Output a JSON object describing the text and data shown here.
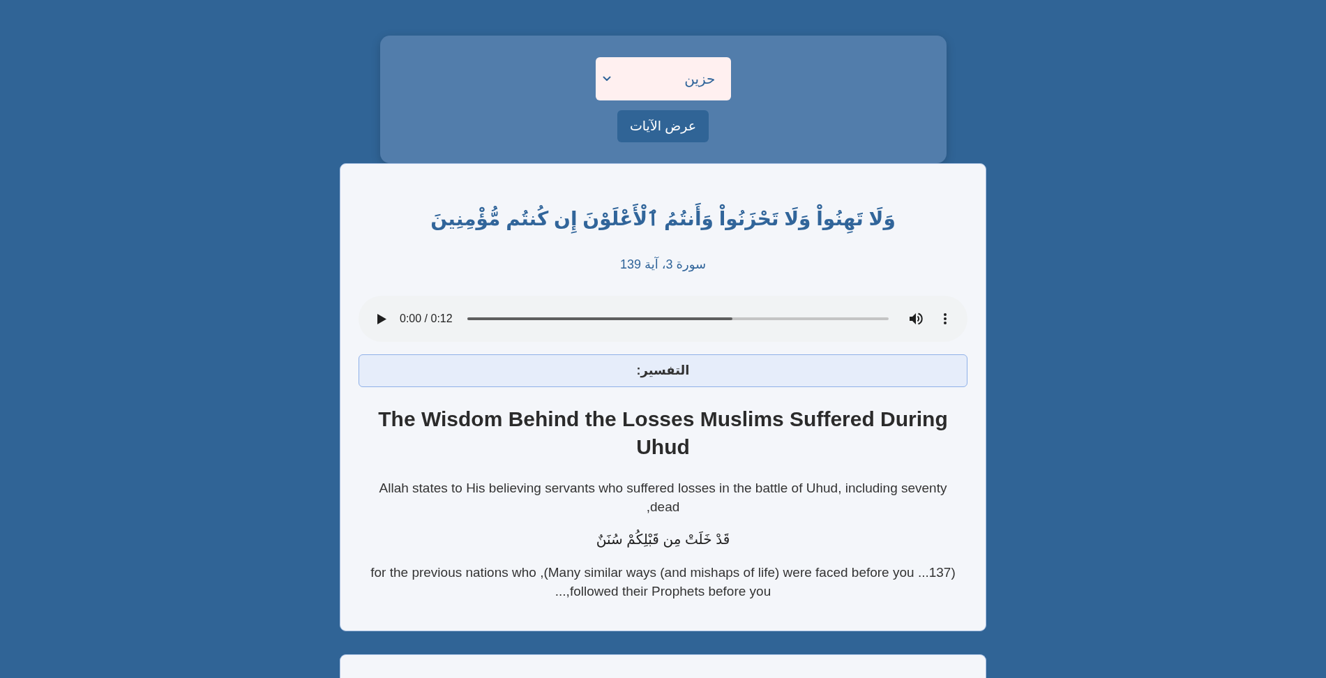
{
  "mood_panel": {
    "select": {
      "value": "حزين"
    },
    "button": "عرض الآيات"
  },
  "verse_card": {
    "verse": "وَلَا تَهِنُواْ وَلَا تَحْزَنُواْ وَأَنتُمُ ٱلْأَعْلَوْنَ إِن كُنتُم مُّؤْمِنِينَ",
    "reference": "سورة 3، آية 139",
    "audio": {
      "time": "0:00 / 0:12",
      "level": 0.63
    },
    "tafsir_label": "التفسير:",
    "tafsir_heading": "The Wisdom Behind the Losses Muslims Suffered During Uhud",
    "tafsir_paragraphs": [
      {
        "kind": "text",
        "text": "Allah states to His believing servants who suffered losses in the battle of Uhud, including seventy dead,"
      },
      {
        "kind": "arabic",
        "text": "قَدْ خَلَتْ مِن قَبْلِكُمْ سُنَنٌ"
      },
      {
        "kind": "text",
        "text": "(137... Many similar ways (and mishaps of life) were faced before you), for the previous nations who followed their Prophets before you,..."
      }
    ]
  },
  "next_card": {
    "visible": true
  }
}
